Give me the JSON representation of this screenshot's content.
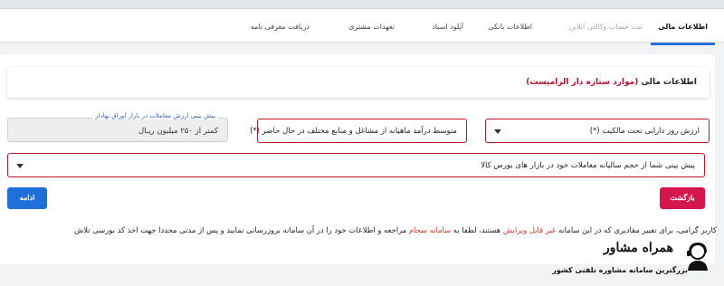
{
  "tabs": [
    {
      "label": "اطلاعات مالی",
      "state": "active"
    },
    {
      "label": "ثبت حساب وکالتی آنلاین",
      "state": "disabled"
    },
    {
      "label": "اطلاعات بانکی",
      "state": "normal"
    },
    {
      "label": "آپلود اسناد",
      "state": "normal"
    },
    {
      "label": "تعهدات مشتری",
      "state": "normal"
    },
    {
      "label": "دریافت معرفی نامه",
      "state": "normal"
    }
  ],
  "section": {
    "title": "اطلاعات مالی",
    "required_note": "(موارد ستاره دار الزامیست)"
  },
  "fields": {
    "asset_value": {
      "label": "ارزش روز دارایی تحت مالکیت (*)"
    },
    "monthly_income": {
      "label": "متوسط درآمد ماهیانه از مشاغل و منابع مختلف در حال حاضر (*)"
    },
    "predicted_value": {
      "legend": "پیش بینی ارزش معاملات در بازار اوراق بهادار",
      "value": "کمتر از ۲۵۰ میلیون ریـال"
    },
    "commodity_volume": {
      "label": "پیش بینی شما از حجم سالیانه معاملات خود در بازار های بورس کالا"
    }
  },
  "buttons": {
    "back": "بازگشت",
    "continue": "ادامه"
  },
  "notice": {
    "part1": "کاربر گرامی، برای تغییر مقادیری که در این سامانه ",
    "part2": "غیر قابل ویرایش",
    "part3": " هستند، لطفا به ",
    "part4": "سامانه سجام",
    "part5": " مراجعه و اطلاعات خود را در آن سامانه بروزرسانی نمایید و پس از مدتی مجددا جهت اخذ کد بورسی تلاش"
  },
  "watermark": {
    "name": "همراه مشاور",
    "tagline": "بزرگترین سامانه مشاوره تلفنی کشور"
  },
  "colors": {
    "accent_red": "#c0152e",
    "button_back": "#d6164b",
    "button_continue": "#1f6fd9",
    "tab_underline": "#2a6fd6",
    "legend_blue": "#3d61c4"
  }
}
